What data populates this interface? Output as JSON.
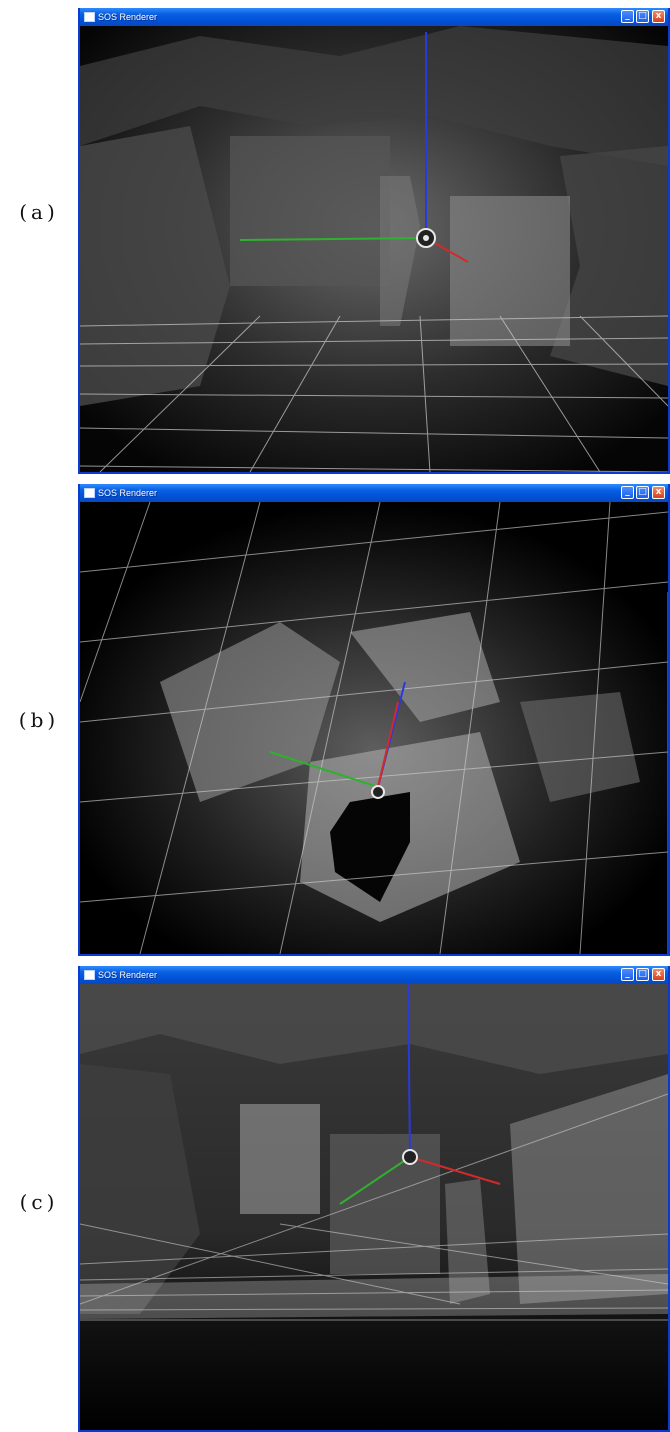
{
  "panels": [
    {
      "label": "(a)",
      "title": "SOS Renderer",
      "controls": {
        "minimize": "_",
        "maximize": "□",
        "close": "x"
      }
    },
    {
      "label": "(b)",
      "title": "SOS Renderer",
      "controls": {
        "minimize": "_",
        "maximize": "□",
        "close": "x"
      }
    },
    {
      "label": "(c)",
      "title": "SOS Renderer",
      "controls": {
        "minimize": "_",
        "maximize": "□",
        "close": "x"
      }
    }
  ],
  "colors": {
    "axis_x": "#d22a2a",
    "axis_y": "#2fb12f",
    "axis_z": "#2a3ad8",
    "grid": "#cfcfcf",
    "titlebar": "#0a5ee0"
  },
  "icons": [
    "window-icon",
    "minimize-icon",
    "maximize-icon",
    "close-icon",
    "origin-marker-icon"
  ]
}
